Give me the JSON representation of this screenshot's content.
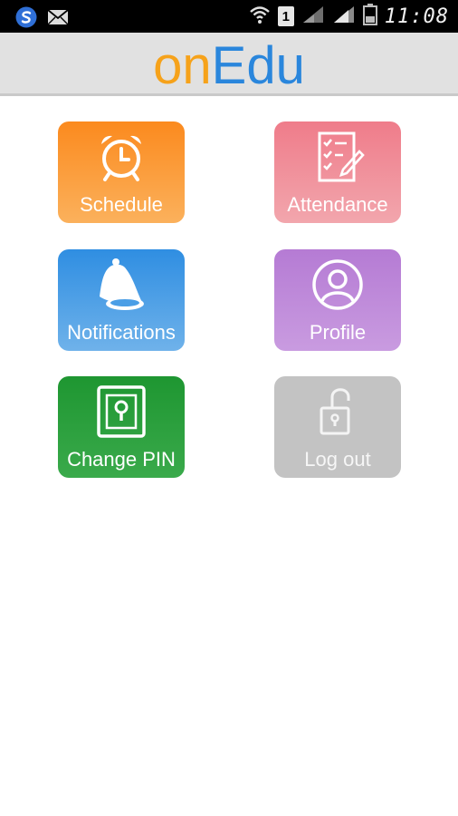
{
  "status_bar": {
    "time": "11:08",
    "sim_slot": "1",
    "icons": [
      "sync-icon",
      "mail-icon",
      "wifi-icon",
      "sim-badge",
      "signal-icon",
      "signal-icon-2",
      "battery-icon"
    ]
  },
  "app": {
    "logo_part1": "on",
    "logo_part2": "Edu",
    "logo_colors": {
      "on": "#f6a21a",
      "edu": "#2a86dc"
    }
  },
  "tiles": [
    {
      "label": "Schedule",
      "icon": "alarm-clock-icon",
      "color": "#fb8a1e"
    },
    {
      "label": "Attendance",
      "icon": "checklist-icon",
      "color": "#ef7c8a"
    },
    {
      "label": "Notifications",
      "icon": "bell-icon",
      "color": "#2f8ee2"
    },
    {
      "label": "Profile",
      "icon": "user-icon",
      "color": "#b57bd4"
    },
    {
      "label": "Change PIN",
      "icon": "keyhole-icon",
      "color": "#1e9631"
    },
    {
      "label": "Log out",
      "icon": "unlocked-padlock-icon",
      "color": "#c3c3c3"
    }
  ]
}
